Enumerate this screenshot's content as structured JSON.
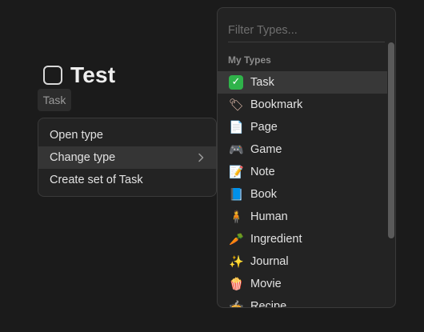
{
  "object": {
    "title": "Test",
    "type_chip": "Task"
  },
  "context_menu": {
    "items": [
      {
        "label": "Open type"
      },
      {
        "label": "Change type"
      },
      {
        "label": "Create set of Task"
      }
    ]
  },
  "type_picker": {
    "filter_placeholder": "Filter Types...",
    "section_label": "My Types",
    "types": [
      {
        "label": "Task",
        "icon": "check-box-icon",
        "glyph": "✓"
      },
      {
        "label": "Bookmark",
        "icon": "bookmark-tag-icon",
        "glyph": "🏷"
      },
      {
        "label": "Page",
        "icon": "page-icon",
        "glyph": "📄"
      },
      {
        "label": "Game",
        "icon": "gamepad-icon",
        "glyph": "🎮"
      },
      {
        "label": "Note",
        "icon": "memo-icon",
        "glyph": "📝"
      },
      {
        "label": "Book",
        "icon": "book-icon",
        "glyph": "📘"
      },
      {
        "label": "Human",
        "icon": "person-icon",
        "glyph": "🧍"
      },
      {
        "label": "Ingredient",
        "icon": "carrot-icon",
        "glyph": "🥕"
      },
      {
        "label": "Journal",
        "icon": "sparkles-icon",
        "glyph": "✨"
      },
      {
        "label": "Movie",
        "icon": "popcorn-icon",
        "glyph": "🍿"
      },
      {
        "label": "Recipe",
        "icon": "pot-icon",
        "glyph": "🍲"
      }
    ]
  }
}
